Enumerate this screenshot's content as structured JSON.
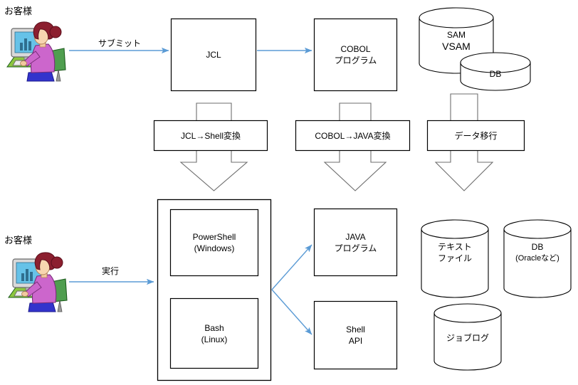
{
  "diagram": {
    "title_absent": true,
    "actors": [
      {
        "name": "customer-top",
        "label": "お客様"
      },
      {
        "name": "customer-bottom",
        "label": "お客様"
      }
    ],
    "edge_labels": [
      {
        "name": "submit",
        "label": "サブミット"
      },
      {
        "name": "execute",
        "label": "実行"
      }
    ],
    "legacy_nodes": [
      {
        "name": "jcl",
        "lines": [
          "JCL"
        ]
      },
      {
        "name": "cobol-program",
        "lines": [
          "COBOL",
          "プログラム"
        ]
      }
    ],
    "legacy_storage": [
      {
        "name": "sam-vsam",
        "lines": [
          "SAM",
          "VSAM"
        ]
      },
      {
        "name": "db-legacy",
        "lines": [
          "DB"
        ]
      }
    ],
    "conversions": [
      {
        "name": "jcl-to-shell",
        "label": "JCL→Shell変換"
      },
      {
        "name": "cobol-to-java",
        "label": "COBOL→JAVA変換"
      },
      {
        "name": "data-migration",
        "label": "データ移行"
      }
    ],
    "target_container": {
      "name": "shell-container",
      "children": [
        {
          "name": "powershell",
          "lines": [
            "PowerShell",
            "(Windows)"
          ]
        },
        {
          "name": "bash",
          "lines": [
            "Bash",
            "(Linux)"
          ]
        }
      ]
    },
    "target_nodes": [
      {
        "name": "java-program",
        "lines": [
          "JAVA",
          "プログラム"
        ]
      },
      {
        "name": "shell-api",
        "lines": [
          "Shell",
          "API"
        ]
      }
    ],
    "target_storage": [
      {
        "name": "text-file",
        "lines": [
          "テキスト",
          "ファイル"
        ]
      },
      {
        "name": "db-oracle",
        "lines": [
          "DB",
          "(Oracleなど)"
        ]
      },
      {
        "name": "job-log",
        "lines": [
          "ジョブログ"
        ]
      }
    ],
    "colors": {
      "arrow_blue": "#5b9bd5",
      "shape_stroke": "#000000",
      "shape_fill": "#ffffff",
      "hair": "#8c1f2f",
      "shirt": "#cc66cc",
      "pants": "#3333cc",
      "chair": "#4f9e4f",
      "monitor_screen": "#66c2e8",
      "monitor_body": "#d9d9d9",
      "skin": "#f2c9a0"
    }
  }
}
